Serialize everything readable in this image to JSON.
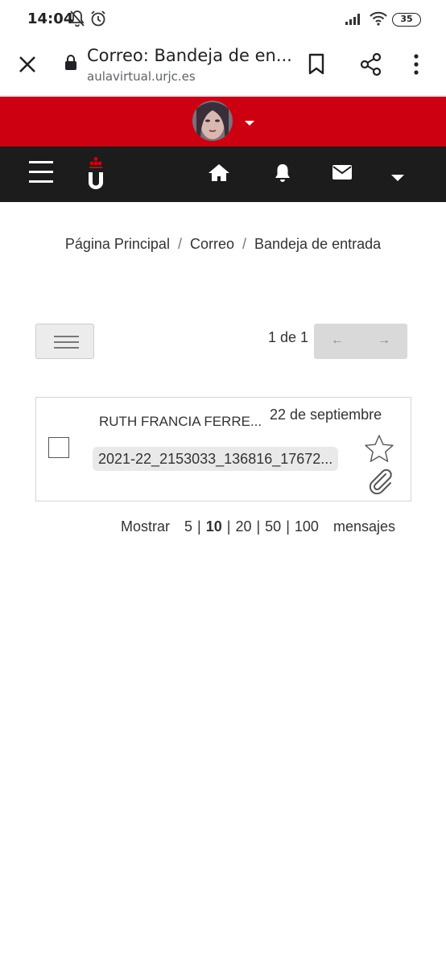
{
  "status_bar": {
    "time": "14:04",
    "battery": "35",
    "icons": [
      "bell-muted-icon",
      "alarm-icon",
      "signal-icon",
      "wifi-icon",
      "battery-icon"
    ]
  },
  "browser": {
    "title": "Correo: Bandeja de en...",
    "url": "aulavirtual.urjc.es",
    "icons": [
      "close-icon",
      "lock-icon",
      "bookmark-icon",
      "share-icon",
      "more-vert-icon"
    ]
  },
  "header": {
    "accent_color": "#cc0010",
    "nav_color": "#1c1c1c",
    "icons": [
      "avatar",
      "caret-down-icon",
      "menu-icon",
      "urjc-logo",
      "home-icon",
      "bell-icon",
      "envelope-icon",
      "caret-down-icon"
    ]
  },
  "breadcrumb": {
    "items": [
      "Página Principal",
      "Correo",
      "Bandeja de entrada"
    ],
    "separator": "/"
  },
  "toolbar": {
    "paging": "1 de 1",
    "prev": "←",
    "next": "→"
  },
  "messages": [
    {
      "sender": "RUTH FRANCIA FERRE...",
      "date": "22 de septiembre",
      "subject": "2021-22_2153033_136816_17672...",
      "starred": false,
      "has_attachment": true
    }
  ],
  "per_page": {
    "prefix": "Mostrar",
    "options": [
      "5",
      "10",
      "20",
      "50",
      "100"
    ],
    "selected": "10",
    "suffix": "mensajes"
  }
}
